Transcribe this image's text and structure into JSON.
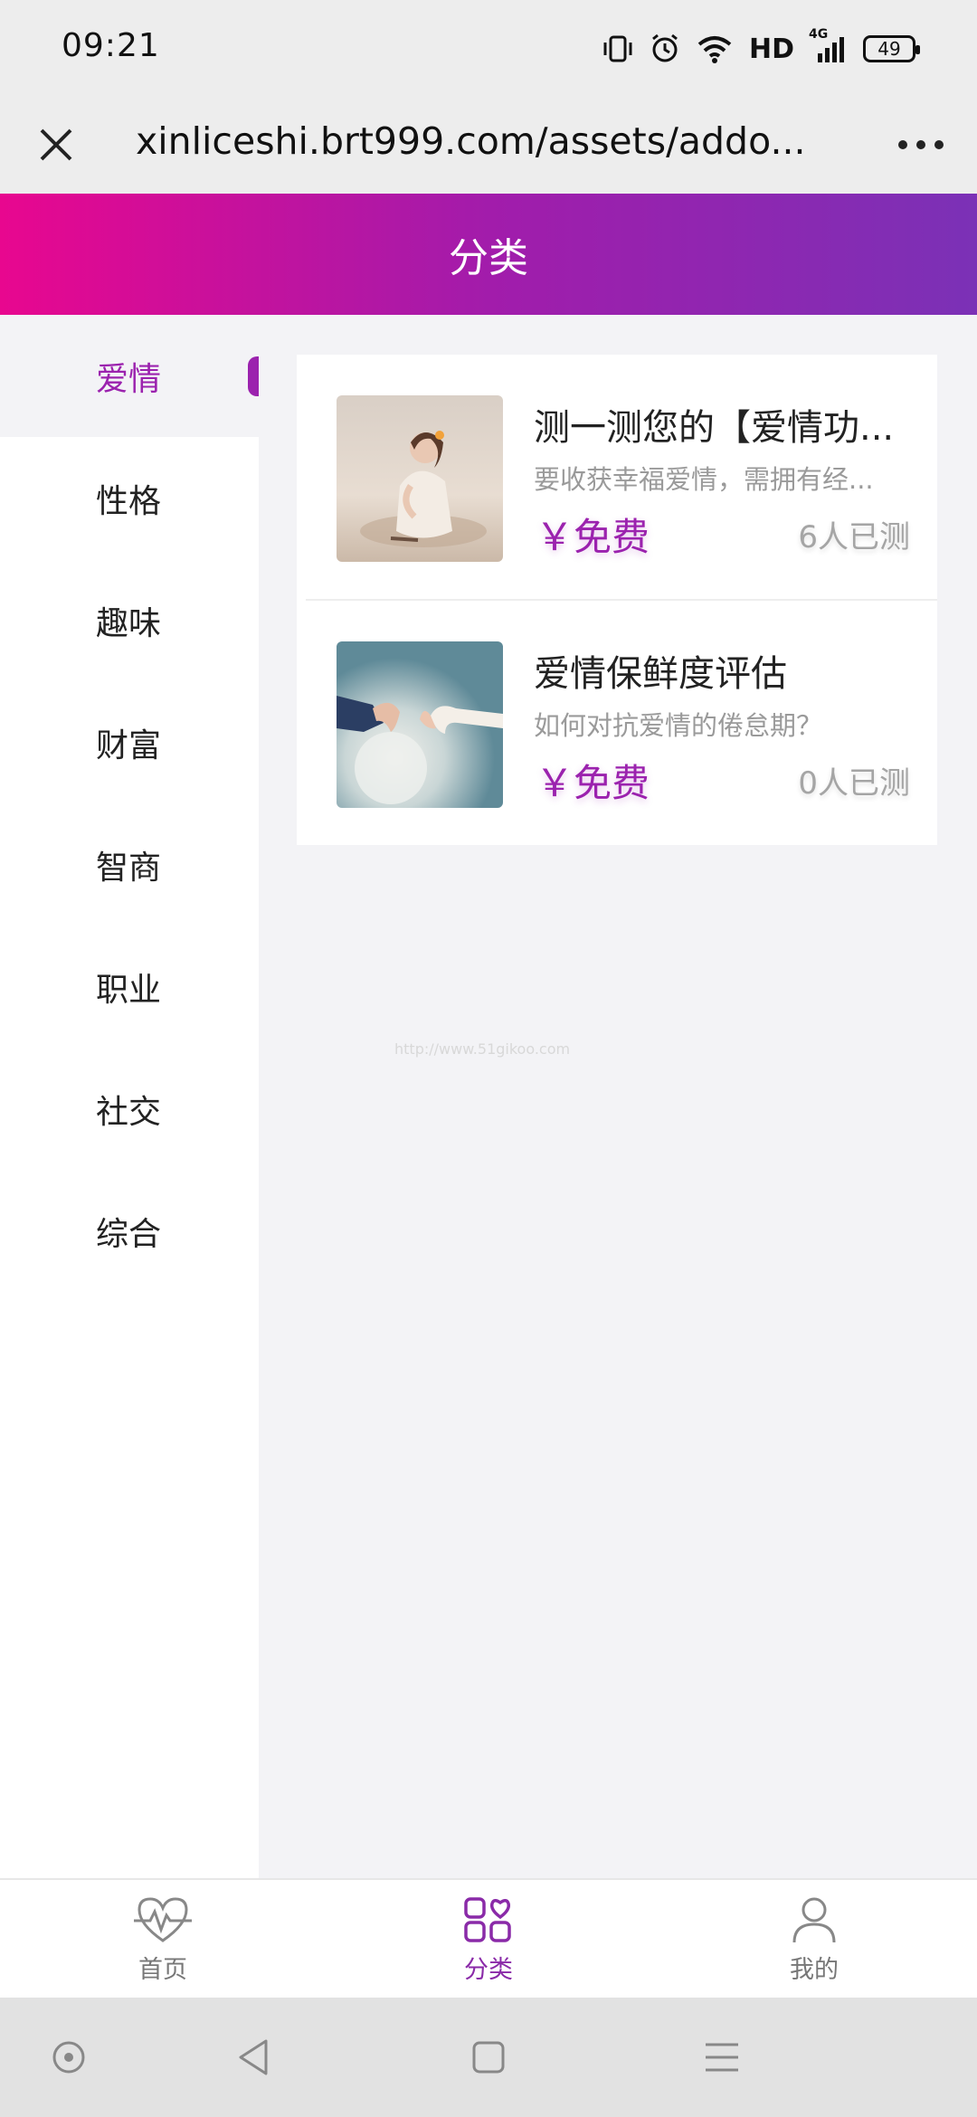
{
  "status_bar": {
    "time": "09:21",
    "network": "HD",
    "signal_type": "4G",
    "battery": "49"
  },
  "browser": {
    "url": "xinliceshi.brt999.com/assets/addo..."
  },
  "header": {
    "title": "分类"
  },
  "sidebar": {
    "items": [
      {
        "label": "爱情",
        "active": true
      },
      {
        "label": "性格"
      },
      {
        "label": "趣味"
      },
      {
        "label": "财富"
      },
      {
        "label": "智商"
      },
      {
        "label": "职业"
      },
      {
        "label": "社交"
      },
      {
        "label": "综合"
      }
    ]
  },
  "list": {
    "items": [
      {
        "title": "测一测您的【爱情功...",
        "desc": "要收获幸福爱情，需拥有经...",
        "price": "￥免费",
        "count": "6人已测"
      },
      {
        "title": "爱情保鲜度评估",
        "desc": "如何对抗爱情的倦怠期？",
        "price": "￥免费",
        "count": "0人已测"
      }
    ]
  },
  "watermark": "http://www.51gikoo.com",
  "bottom_nav": {
    "tabs": [
      {
        "label": "首页",
        "icon": "heartbeat-icon"
      },
      {
        "label": "分类",
        "icon": "category-icon",
        "active": true
      },
      {
        "label": "我的",
        "icon": "user-icon"
      }
    ]
  },
  "colors": {
    "accent": "#9b22ae",
    "header_start": "#e8078f",
    "header_end": "#7b31b6"
  }
}
